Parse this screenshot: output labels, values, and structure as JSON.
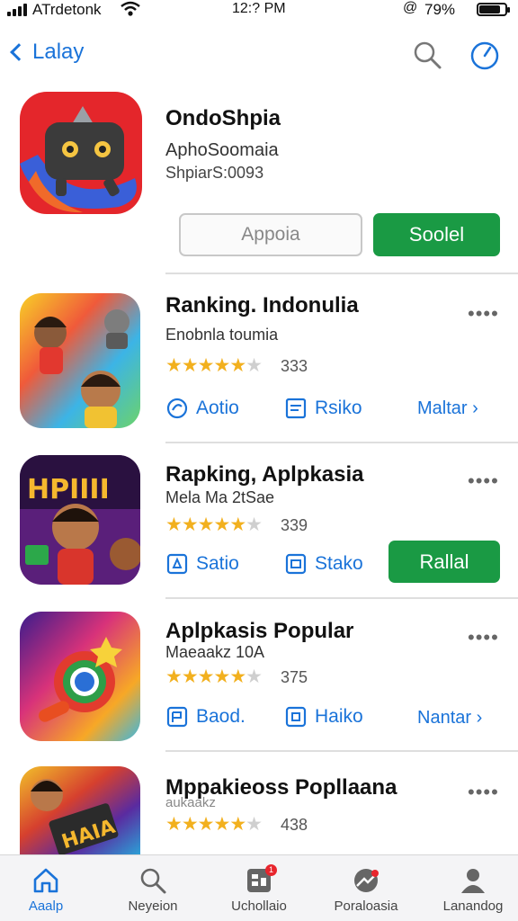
{
  "status": {
    "carrier": "ATrdetonk",
    "time": "12:? PM",
    "battery": "79%"
  },
  "nav": {
    "back_label": "Lalay"
  },
  "featured": {
    "title": "OndoShpia",
    "subtitle": "AphoSoomaia",
    "meta": "ShpiarS:0093",
    "secondary_button": "Appoia",
    "primary_button": "Soolel"
  },
  "items": [
    {
      "title": "Ranking. Indonulia",
      "subtitle": "Enobnla toumia",
      "rating": 4.5,
      "rating_count": "333",
      "action1": "Aotio",
      "action2": "Rsiko",
      "more": "Maltar"
    },
    {
      "title": "Rapking, Aplpkasia",
      "subtitle": "Mela Ma 2tSae",
      "rating": 4.5,
      "rating_count": "339",
      "action1": "Satio",
      "action2": "Stako",
      "button": "Rallal"
    },
    {
      "title": "Aplpkasis Popular",
      "subtitle": "Maeaakz 10A",
      "rating": 4.5,
      "rating_count": "375",
      "action1": "Baod.",
      "action2": "Haiko",
      "more": "Nantar"
    },
    {
      "title": "Mppakieoss Popllaana",
      "subtitle": "aukaakz",
      "rating": 4.5,
      "rating_count": "438"
    }
  ],
  "tabs": [
    {
      "label": "Aaalp",
      "badge": ""
    },
    {
      "label": "Neyeion",
      "badge": ""
    },
    {
      "label": "Uchollaio",
      "badge": "1"
    },
    {
      "label": "Poraloasia",
      "badge": ""
    },
    {
      "label": "Lanandog",
      "badge": ""
    }
  ],
  "colors": {
    "accent": "#1a73d9",
    "green": "#1a9a44",
    "star": "#f2b01e"
  }
}
